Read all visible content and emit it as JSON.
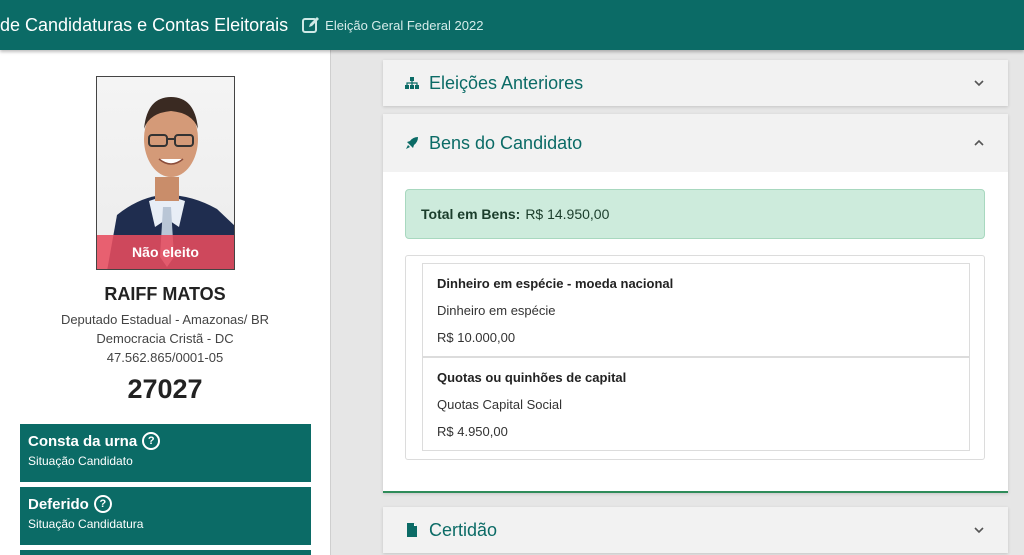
{
  "header": {
    "title": "de Candidaturas e Contas Eleitorais",
    "election": "Eleição Geral Federal 2022"
  },
  "candidate": {
    "badge": "Não eleito",
    "name": "RAIFF MATOS",
    "office": "Deputado Estadual - Amazonas/ BR",
    "party": "Democracia Cristã - DC",
    "cnpj": "47.562.865/0001-05",
    "number": "27027"
  },
  "status": [
    {
      "title": "Consta da urna",
      "subtitle": "Situação Candidato"
    },
    {
      "title": "Deferido",
      "subtitle": "Situação Candidatura"
    }
  ],
  "panels": {
    "previous_elections": "Eleições Anteriores",
    "assets": "Bens do Candidato",
    "certificate": "Certidão"
  },
  "assets": {
    "total_label": "Total em Bens:",
    "total_value": "R$ 14.950,00",
    "items": [
      {
        "title": "Dinheiro em espécie - moeda nacional",
        "description": "Dinheiro em espécie",
        "value": "R$ 10.000,00"
      },
      {
        "title": "Quotas ou quinhões de capital",
        "description": "Quotas Capital Social",
        "value": "R$ 4.950,00"
      }
    ]
  },
  "colors": {
    "primary": "#0b6b66",
    "badge": "#e74c5e",
    "total_bg": "#cdebdc",
    "panel_border": "#2f8c5a"
  }
}
